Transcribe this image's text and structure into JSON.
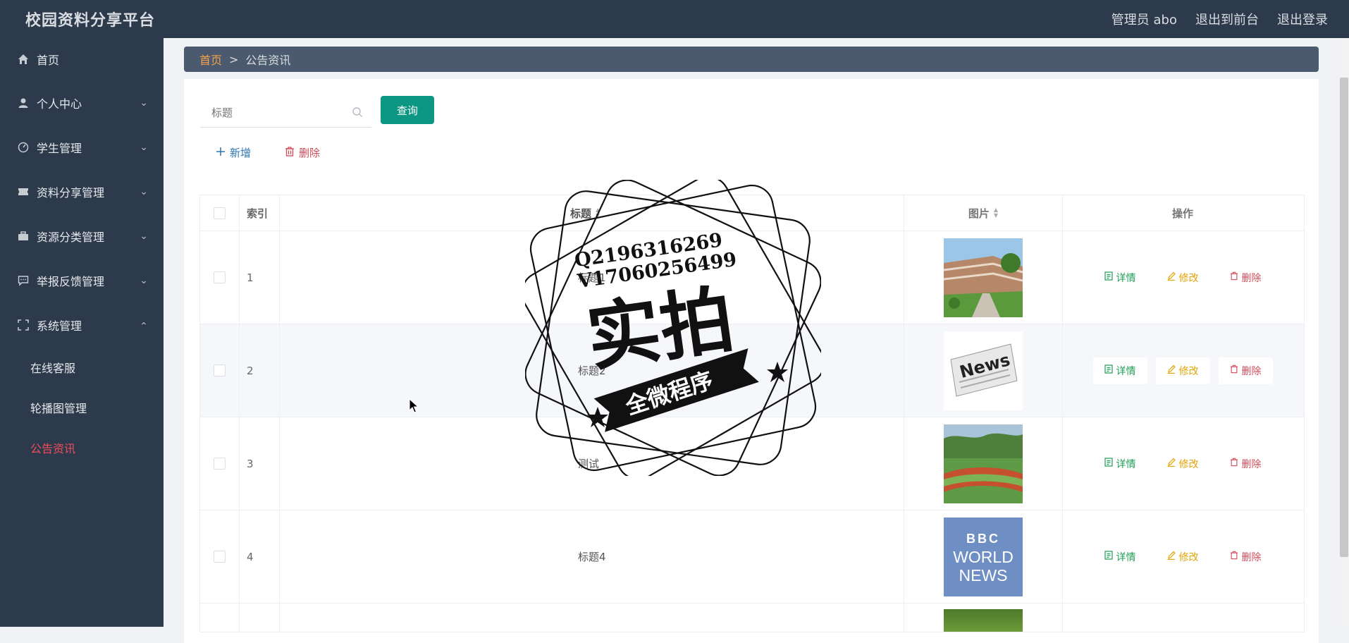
{
  "header": {
    "title": "校园资料分享平台",
    "admin": "管理员 abo",
    "exit_front": "退出到前台",
    "logout": "退出登录"
  },
  "sidebar": {
    "items": [
      {
        "label": "首页",
        "icon": "home-icon"
      },
      {
        "label": "个人中心",
        "icon": "user-icon"
      },
      {
        "label": "学生管理",
        "icon": "gauge-icon"
      },
      {
        "label": "资料分享管理",
        "icon": "ticket-icon"
      },
      {
        "label": "资源分类管理",
        "icon": "briefcase-icon"
      },
      {
        "label": "举报反馈管理",
        "icon": "chat-icon"
      },
      {
        "label": "系统管理",
        "icon": "fullscreen-icon"
      }
    ],
    "sub_items": [
      {
        "label": "在线客服"
      },
      {
        "label": "轮播图管理"
      },
      {
        "label": "公告资讯",
        "active": true
      }
    ]
  },
  "breadcrumb": {
    "home": "首页",
    "sep": ">",
    "current": "公告资讯"
  },
  "search": {
    "placeholder": "标题",
    "query_label": "查询"
  },
  "actions": {
    "add_label": "新增",
    "delete_label": "删除"
  },
  "table": {
    "columns": {
      "index": "索引",
      "title": "标题",
      "image": "图片",
      "ops": "操作"
    },
    "rows": [
      {
        "index": "1",
        "title": "标题1",
        "image": "campus-building"
      },
      {
        "index": "2",
        "title": "标题2",
        "image": "newspaper"
      },
      {
        "index": "3",
        "title": "测试",
        "image": "sports-field"
      },
      {
        "index": "4",
        "title": "标题4",
        "image": "bbc-world-news",
        "image_text": [
          "BBC",
          "WORLD",
          "NEWS"
        ]
      }
    ],
    "op_labels": {
      "detail": "详情",
      "edit": "修改",
      "delete": "删除"
    }
  },
  "watermark": {
    "line1": "Q2196316269",
    "line2": "V17060256499",
    "main": "实拍",
    "ribbon": "全微程序"
  },
  "colors": {
    "sidebar_bg": "#2d3a4b",
    "accent": "#0b9783",
    "active": "#ef4d5d",
    "home_crumb": "#f3a34a"
  }
}
